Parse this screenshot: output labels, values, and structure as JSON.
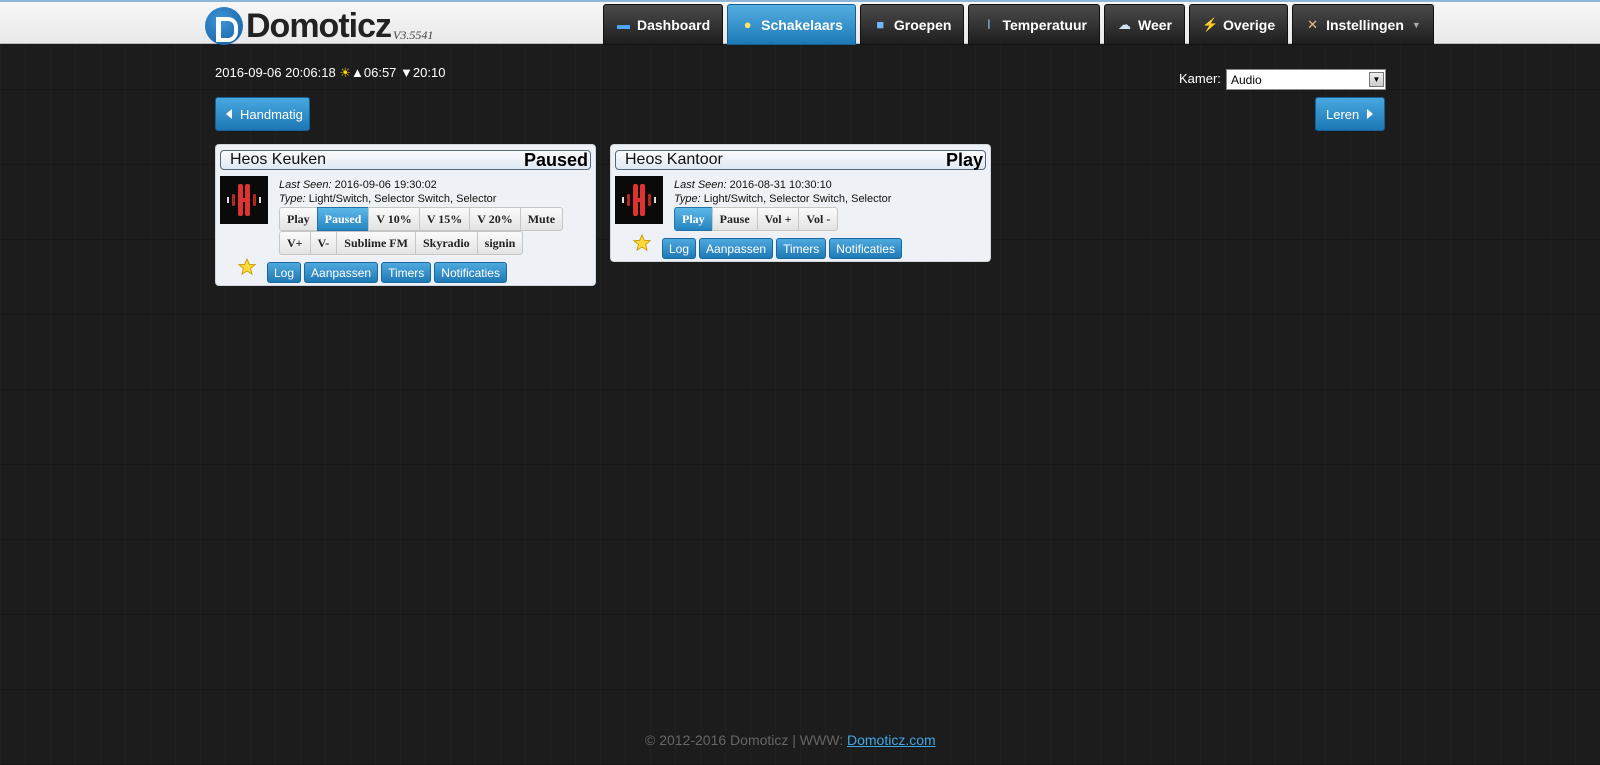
{
  "brand": {
    "name": "Domoticz",
    "version": "V3.5541"
  },
  "nav": [
    {
      "label": "Dashboard",
      "icon": "monitor-icon"
    },
    {
      "label": "Schakelaars",
      "icon": "lightbulb-icon",
      "active": true
    },
    {
      "label": "Groepen",
      "icon": "clapper-icon"
    },
    {
      "label": "Temperatuur",
      "icon": "thermometer-icon"
    },
    {
      "label": "Weer",
      "icon": "cloud-rain-icon"
    },
    {
      "label": "Overige",
      "icon": "utility-icon"
    },
    {
      "label": "Instellingen",
      "icon": "tools-icon",
      "dropdown": true
    }
  ],
  "info": {
    "datetime": "2016-09-06 20:06:18",
    "sunrise": "06:57",
    "sunset": "20:10"
  },
  "room": {
    "label": "Kamer:",
    "selected": "Audio"
  },
  "buttons": {
    "manual": "Handmatig",
    "learn": "Leren"
  },
  "devices": [
    {
      "name": "Heos Keuken",
      "status": "Paused",
      "last_seen_label": "Last Seen:",
      "last_seen": "2016-09-06 19:30:02",
      "type_label": "Type:",
      "type": "Light/Switch, Selector Switch, Selector",
      "levels_row1": [
        "Play",
        "Paused",
        "V 10%",
        "V 15%",
        "V 20%",
        "Mute"
      ],
      "levels_row2": [
        "V+",
        "V-",
        "Sublime FM",
        "Skyradio",
        "signin"
      ],
      "active_level": "Paused",
      "actions": [
        "Log",
        "Aanpassen",
        "Timers",
        "Notificaties"
      ]
    },
    {
      "name": "Heos Kantoor",
      "status": "Play",
      "last_seen_label": "Last Seen:",
      "last_seen": "2016-08-31 10:30:10",
      "type_label": "Type:",
      "type": "Light/Switch, Selector Switch, Selector",
      "levels_row1": [
        "Play",
        "Pause",
        "Vol +",
        "Vol -"
      ],
      "active_level": "Play",
      "actions": [
        "Log",
        "Aanpassen",
        "Timers",
        "Notificaties"
      ]
    }
  ],
  "footer": {
    "copyright": "© 2012-2016 Domoticz | WWW:",
    "link": "Domoticz.com"
  },
  "colors": {
    "accent": "#2584c0",
    "nav_dark": "#1e1e1e",
    "background": "#1c1c1c"
  }
}
